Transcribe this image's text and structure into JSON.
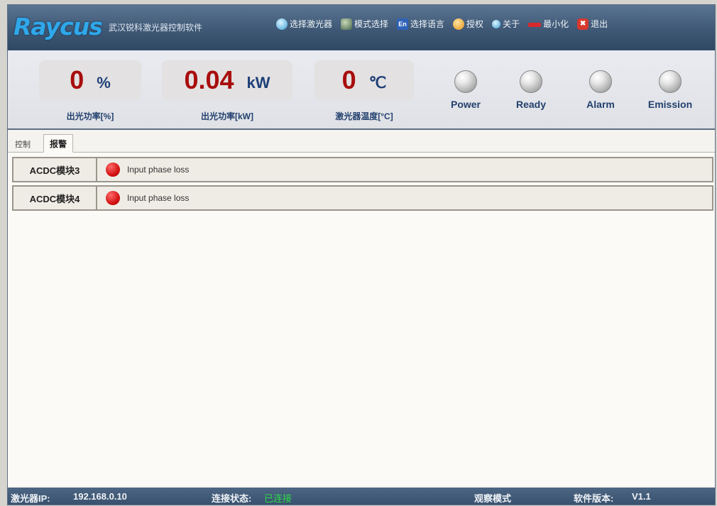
{
  "header": {
    "logo_text": "Raycus",
    "app_name": "武汉锐科激光器控制软件",
    "menu": [
      {
        "label": "选择激光器",
        "icon": "laser-select-icon"
      },
      {
        "label": "模式选择",
        "icon": "mode-select-icon"
      },
      {
        "label": "选择语言",
        "icon": "language-icon"
      },
      {
        "label": "授权",
        "icon": "authorize-icon"
      },
      {
        "label": "关于",
        "icon": "about-icon"
      },
      {
        "label": "最小化",
        "icon": "minimize-icon"
      },
      {
        "label": "退出",
        "icon": "exit-icon"
      }
    ],
    "lang_glyph": "En",
    "exit_glyph": "✖"
  },
  "readouts": [
    {
      "value": "0",
      "unit": "%",
      "label": "出光功率[%]"
    },
    {
      "value": "0.04",
      "unit": "kW",
      "label": "出光功率[kW]"
    },
    {
      "value": "0",
      "unit": "℃",
      "label": "激光器温度[°C]"
    }
  ],
  "indicators": [
    "Power",
    "Ready",
    "Alarm",
    "Emission"
  ],
  "tabs": {
    "control": "控制",
    "alarm": "报警"
  },
  "alarms": [
    {
      "module": "ACDC模块3",
      "message": "Input phase loss"
    },
    {
      "module": "ACDC模块4",
      "message": "Input phase loss"
    }
  ],
  "statusbar": {
    "ip_label": "激光器IP:",
    "ip_value": "192.168.0.10",
    "conn_label": "连接状态:",
    "conn_value": "已连接",
    "mode": "观察模式",
    "version_label": "软件版本:",
    "version_value": "V1.1"
  },
  "colors": {
    "accent": "#a80d0d",
    "label": "#23406d",
    "connected": "#2ed84a"
  }
}
